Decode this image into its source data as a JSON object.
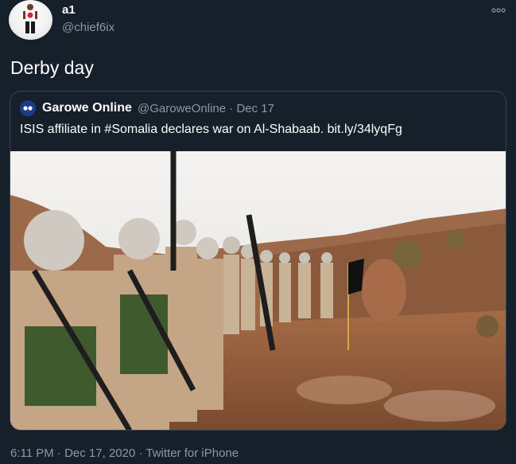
{
  "tweet": {
    "display_name": "a1",
    "handle": "@chief6ix",
    "text": "Derby day",
    "avatar_icon": "profile-photo",
    "more_icon": "more-dots-icon"
  },
  "quote": {
    "name": "Garowe Online",
    "handle": "@GaroweOnline",
    "separator": "·",
    "date": "Dec 17",
    "text": "ISIS affiliate in #Somalia declares war on Al-Shabaab. bit.ly/34lyqFg",
    "photo_icon": "news-photo"
  },
  "footer": {
    "time": "6:11 PM",
    "date": "Dec 17, 2020",
    "source": "Twitter for iPhone",
    "separator": "·"
  },
  "colors": {
    "background": "#15202b",
    "secondary_text": "#8899a6",
    "border": "#38444d"
  }
}
